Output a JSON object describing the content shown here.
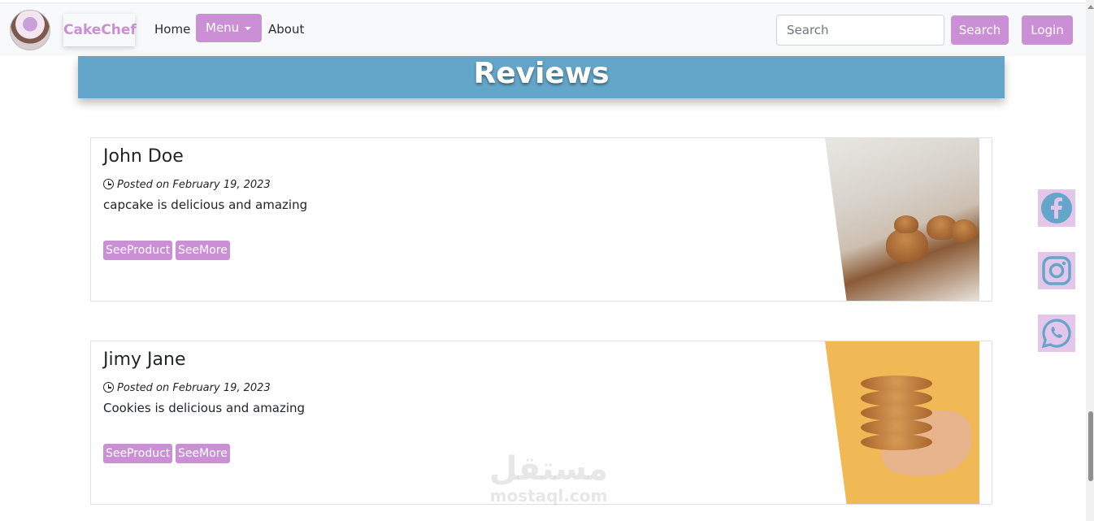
{
  "nav": {
    "brand": "CakeChef",
    "home": "Home",
    "menu": "Menu",
    "about": "About",
    "search_placeholder": "Search",
    "search_button": "Search",
    "login_button": "Login"
  },
  "page_title": "Reviews",
  "reviews": [
    {
      "name": "John Doe",
      "date": "Posted on February 19, 2023",
      "text": "capcake is delicious and amazing",
      "see_product": "SeeProduct",
      "see_more": "SeeMore",
      "image_icon": "muffins-photo"
    },
    {
      "name": "Jimy Jane",
      "date": "Posted on February 19, 2023",
      "text": "Cookies is delicious and amazing",
      "see_product": "SeeProduct",
      "see_more": "SeeMore",
      "image_icon": "cookies-photo"
    }
  ],
  "social": [
    "facebook-icon",
    "instagram-icon",
    "whatsapp-icon"
  ],
  "watermark": {
    "arabic": "مستقل",
    "latin": "mostaql.com"
  },
  "colors": {
    "accent": "#cb8fd6",
    "banner": "#64a6c9",
    "social_bg": "#e3c6ea",
    "icon": "#64a6c9"
  }
}
